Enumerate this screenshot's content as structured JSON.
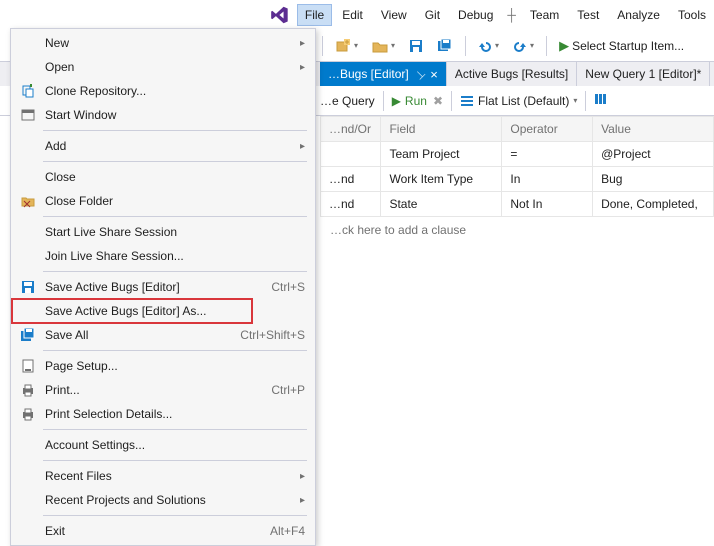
{
  "menubar": {
    "items": [
      "File",
      "Edit",
      "View",
      "Git",
      "Debug",
      "Team",
      "Test",
      "Analyze",
      "Tools"
    ],
    "active": 0
  },
  "toolbar": {
    "startup": "Select Startup Item..."
  },
  "tabs": {
    "t0": {
      "label": "…Bugs [Editor]"
    },
    "t1": {
      "label": "Active Bugs [Results]"
    },
    "t2": {
      "label": "New Query 1 [Editor]*"
    }
  },
  "qtoolbar": {
    "query": "…e Query",
    "run": "Run",
    "flatlist": "Flat List (Default)"
  },
  "grid": {
    "headers": {
      "h0": "…nd/Or",
      "h1": "Field",
      "h2": "Operator",
      "h3": "Value"
    },
    "rows": [
      {
        "c0": "",
        "c1": "Team Project",
        "c2": "=",
        "c3": "@Project"
      },
      {
        "c0": "…nd",
        "c1": "Work Item Type",
        "c2": "In",
        "c3": "Bug"
      },
      {
        "c0": "…nd",
        "c1": "State",
        "c2": "Not In",
        "c3": "Done, Completed,"
      }
    ],
    "addclause": "…ck here to add a clause"
  },
  "fileMenu": {
    "items": [
      {
        "type": "item",
        "icon": "",
        "label": "New",
        "sub": true
      },
      {
        "type": "item",
        "icon": "",
        "label": "Open",
        "sub": true
      },
      {
        "type": "item",
        "icon": "clone",
        "label": "Clone Repository..."
      },
      {
        "type": "item",
        "icon": "window",
        "label": "Start Window"
      },
      {
        "type": "sep"
      },
      {
        "type": "item",
        "icon": "",
        "label": "Add",
        "sub": true
      },
      {
        "type": "sep"
      },
      {
        "type": "item",
        "icon": "",
        "label": "Close"
      },
      {
        "type": "item",
        "icon": "closefolder",
        "label": "Close Folder"
      },
      {
        "type": "sep"
      },
      {
        "type": "item",
        "icon": "",
        "label": "Start Live Share Session"
      },
      {
        "type": "item",
        "icon": "",
        "label": "Join Live Share Session..."
      },
      {
        "type": "sep"
      },
      {
        "type": "item",
        "icon": "save",
        "label": "Save Active Bugs [Editor]",
        "shortcut": "Ctrl+S"
      },
      {
        "type": "item",
        "icon": "",
        "label": "Save Active Bugs [Editor] As...",
        "highlight": true
      },
      {
        "type": "item",
        "icon": "saveall",
        "label": "Save All",
        "shortcut": "Ctrl+Shift+S"
      },
      {
        "type": "sep"
      },
      {
        "type": "item",
        "icon": "page",
        "label": "Page Setup..."
      },
      {
        "type": "item",
        "icon": "print",
        "label": "Print...",
        "shortcut": "Ctrl+P"
      },
      {
        "type": "item",
        "icon": "print",
        "label": "Print Selection Details..."
      },
      {
        "type": "sep"
      },
      {
        "type": "item",
        "icon": "",
        "label": "Account Settings..."
      },
      {
        "type": "sep"
      },
      {
        "type": "item",
        "icon": "",
        "label": "Recent Files",
        "sub": true
      },
      {
        "type": "item",
        "icon": "",
        "label": "Recent Projects and Solutions",
        "sub": true
      },
      {
        "type": "sep"
      },
      {
        "type": "item",
        "icon": "",
        "label": "Exit",
        "shortcut": "Alt+F4"
      }
    ]
  }
}
